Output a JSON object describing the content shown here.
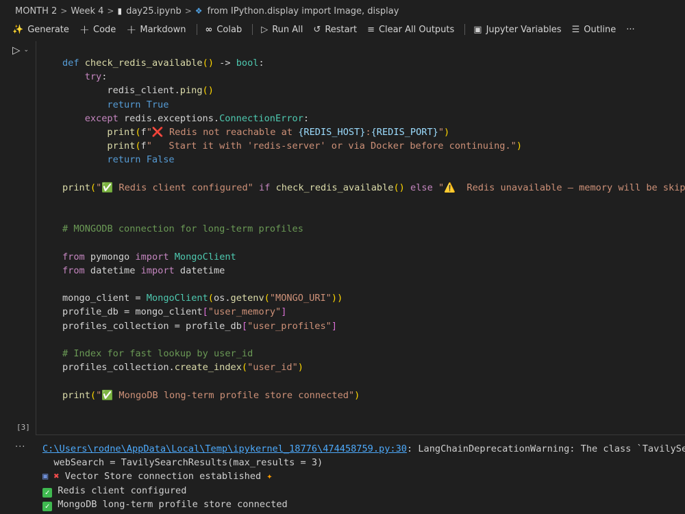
{
  "breadcrumb": {
    "items": [
      "MONTH 2",
      "Week 4",
      "day25.ipynb",
      "from IPython.display import Image, display"
    ],
    "separator": ">"
  },
  "toolbar": {
    "generate": "Generate",
    "code": "Code",
    "markdown": "Markdown",
    "colab": "Colab",
    "run_all": "Run All",
    "restart": "Restart",
    "clear_outputs": "Clear All Outputs",
    "jupyter_variables": "Jupyter Variables",
    "outline": "Outline",
    "more": "···"
  },
  "cell": {
    "execution_count": "[3]",
    "code": {
      "l0": "def check_redis_available() -> bool:",
      "l1": "try:",
      "l2": "redis_client.ping()",
      "l3": "return True",
      "l4": "except redis.exceptions.ConnectionError:",
      "l5": "print(f\"❌ Redis not reachable at {REDIS_HOST}:{REDIS_PORT}\")",
      "l6": "print(f\"   Start it with 'redis-server' or via Docker before continuing.\")",
      "l7": "return False",
      "l8": "print(\"✅ Redis client configured\" if check_redis_available() else \"⚠️  Redis unavailable — memory will be skip",
      "l9": "# MONGODB connection for long-term profiles",
      "l10": "from pymongo import MongoClient",
      "l11": "from datetime import datetime",
      "l12": "mongo_client = MongoClient(os.getenv(\"MONGO_URI\"))",
      "l13": "profile_db = mongo_client[\"user_memory\"]",
      "l14": "profiles_collection = profile_db[\"user_profiles\"]",
      "l15": "# Index for fast lookup by user_id",
      "l16": "profiles_collection.create_index(\"user_id\")",
      "l17": "print(\"✅ MongoDB long-term profile store connected\")"
    }
  },
  "output": {
    "menu": "···",
    "warning_path": "C:\\Users\\rodne\\AppData\\Local\\Temp\\ipykernel_18776\\474458759.py:30",
    "warning_text": ": LangChainDeprecationWarning: The class `TavilySe",
    "warning_line2": "  webSearch = TavilySearchResults(max_results = 3)",
    "line3": "Vector Store connection established",
    "line4": "Redis client configured",
    "line5": "MongoDB long-term profile store connected"
  }
}
